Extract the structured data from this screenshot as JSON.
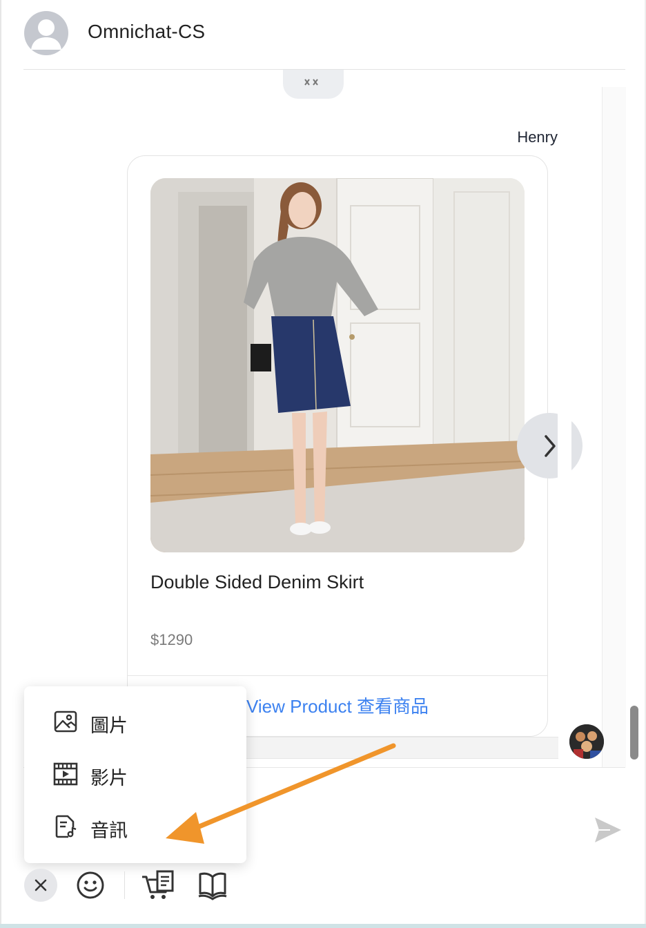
{
  "header": {
    "title": "Omnichat-CS"
  },
  "message": {
    "sender": "Henry",
    "product": {
      "title": "Double Sided Denim Skirt",
      "price": "$1290",
      "cta": "View Product 查看商品"
    }
  },
  "attach_menu": {
    "items": [
      {
        "label": "圖片",
        "icon": "image-icon"
      },
      {
        "label": "影片",
        "icon": "video-icon"
      },
      {
        "label": "音訊",
        "icon": "audio-file-icon"
      }
    ]
  },
  "toolbar": {
    "icons": [
      "close-icon",
      "emoji-icon",
      "cart-icon",
      "book-icon"
    ]
  },
  "colors": {
    "link": "#3d82f0",
    "annotation_arrow": "#f0952b"
  }
}
